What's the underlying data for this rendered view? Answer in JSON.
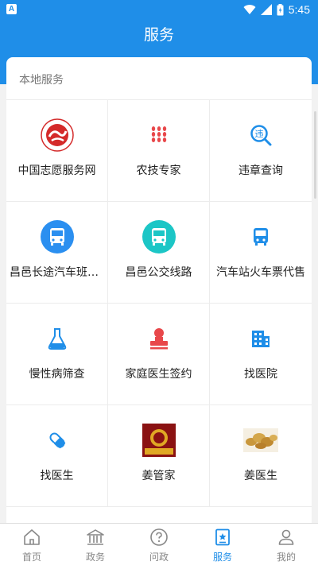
{
  "status_bar": {
    "time": "5:45"
  },
  "header": {
    "title": "服务"
  },
  "section": {
    "title": "本地服务"
  },
  "services": [
    {
      "label": "中国志愿服务网",
      "icon": "volunteer-logo-icon"
    },
    {
      "label": "农技专家",
      "icon": "wheat-icon"
    },
    {
      "label": "违章查询",
      "icon": "violation-search-icon"
    },
    {
      "label": "昌邑长途汽车班次...",
      "icon": "bus-icon"
    },
    {
      "label": "昌邑公交线路",
      "icon": "bus-icon"
    },
    {
      "label": "汽车站火车票代售",
      "icon": "bus-small-icon"
    },
    {
      "label": "慢性病筛查",
      "icon": "flask-icon"
    },
    {
      "label": "家庭医生签约",
      "icon": "doctor-stamp-icon"
    },
    {
      "label": "找医院",
      "icon": "hospital-icon"
    },
    {
      "label": "找医生",
      "icon": "stethoscope-icon"
    },
    {
      "label": "姜管家",
      "icon": "ginger-steward-logo-icon"
    },
    {
      "label": "姜医生",
      "icon": "ginger-image-icon"
    }
  ],
  "tabs": [
    {
      "label": "首页",
      "icon": "home-icon"
    },
    {
      "label": "政务",
      "icon": "government-icon"
    },
    {
      "label": "问政",
      "icon": "question-icon"
    },
    {
      "label": "服务",
      "icon": "star-bookmark-icon",
      "active": true
    },
    {
      "label": "我的",
      "icon": "user-icon"
    }
  ],
  "colors": {
    "primary": "#1f8ee8",
    "red": "#e8474a",
    "cyan": "#1cc6c6"
  }
}
